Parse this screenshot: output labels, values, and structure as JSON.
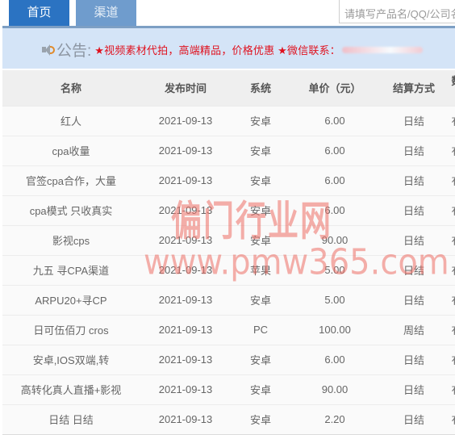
{
  "nav": {
    "tabs": [
      {
        "label": "首页",
        "active": true
      },
      {
        "label": "渠道",
        "active": false
      }
    ],
    "search_placeholder": "请填写产品名/QQ/公司名"
  },
  "notice": {
    "icon": "speaker-icon",
    "label": "公告:",
    "text": "★视频素材代拍，高端精品，价格优惠 ★微信联系："
  },
  "table": {
    "headers": [
      "名称",
      "发布时间",
      "系统",
      "单价（元）",
      "结算方式",
      "数据查看"
    ],
    "rows": [
      {
        "name": "红人",
        "date": "2021-09-13",
        "system": "安卓",
        "price": "6.00",
        "settlement": "日结",
        "data_view": "有后台"
      },
      {
        "name": "cpa收量",
        "date": "2021-09-13",
        "system": "安卓",
        "price": "6.00",
        "settlement": "日结",
        "data_view": "有后台"
      },
      {
        "name": "官签cpa合作，大量",
        "date": "2021-09-13",
        "system": "安卓",
        "price": "6.00",
        "settlement": "日结",
        "data_view": "有后台"
      },
      {
        "name": "cpa模式 只收真实",
        "date": "2021-09-13",
        "system": "安卓",
        "price": "6.00",
        "settlement": "日结",
        "data_view": "有后台"
      },
      {
        "name": "影视cps",
        "date": "2021-09-13",
        "system": "安卓",
        "price": "90.00",
        "settlement": "日结",
        "data_view": "有后台"
      },
      {
        "name": "九五 寻CPA渠道",
        "date": "2021-09-13",
        "system": "苹果",
        "price": "5.00",
        "settlement": "日结",
        "data_view": "有后台"
      },
      {
        "name": "ARPU20+寻CP",
        "date": "2021-09-13",
        "system": "安卓",
        "price": "5.00",
        "settlement": "日结",
        "data_view": "有后台"
      },
      {
        "name": "日可伍佰刀 cros",
        "date": "2021-09-13",
        "system": "PC",
        "price": "100.00",
        "settlement": "周结",
        "data_view": "有后台"
      },
      {
        "name": "安卓,IOS双端,转",
        "date": "2021-09-13",
        "system": "安卓",
        "price": "6.00",
        "settlement": "日结",
        "data_view": "有后台"
      },
      {
        "name": "高转化真人直播+影视",
        "date": "2021-09-13",
        "system": "安卓",
        "price": "90.00",
        "settlement": "日结",
        "data_view": "有后台"
      },
      {
        "name": "日结 日结",
        "date": "2021-09-13",
        "system": "安卓",
        "price": "2.20",
        "settlement": "日结",
        "data_view": "有后台"
      }
    ]
  },
  "watermark": {
    "line1": "偏门行业网",
    "line2": "www.pmw365.com"
  },
  "colors": {
    "tab_active": "#2b73c2",
    "tab_inactive": "#6f9ccd",
    "notice_bg": "#d4e4f7",
    "notice_text": "#e0121f",
    "header_bg": "#efefef"
  }
}
